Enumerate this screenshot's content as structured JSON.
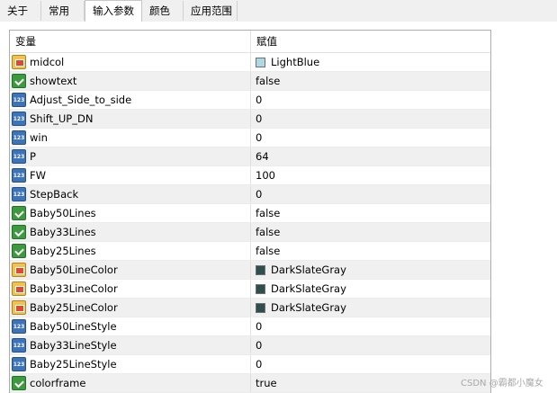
{
  "tabs": [
    {
      "label": "关于",
      "active": false
    },
    {
      "label": "常用",
      "active": false
    },
    {
      "label": "输入参数",
      "active": true
    },
    {
      "label": "颜色",
      "active": false
    },
    {
      "label": "应用范围",
      "active": false
    }
  ],
  "table": {
    "headers": {
      "variable": "变量",
      "value": "赋值"
    },
    "rows": [
      {
        "name": "midcol",
        "value": "LightBlue",
        "type": "color",
        "swatch": "#add8e6"
      },
      {
        "name": "showtext",
        "value": "false",
        "type": "bool"
      },
      {
        "name": "Adjust_Side_to_side",
        "value": "0",
        "type": "num"
      },
      {
        "name": "Shift_UP_DN",
        "value": "0",
        "type": "num"
      },
      {
        "name": "win",
        "value": "0",
        "type": "num"
      },
      {
        "name": "P",
        "value": "64",
        "type": "num"
      },
      {
        "name": "FW",
        "value": "100",
        "type": "num"
      },
      {
        "name": "StepBack",
        "value": "0",
        "type": "num"
      },
      {
        "name": "Baby50Lines",
        "value": "false",
        "type": "bool"
      },
      {
        "name": "Baby33Lines",
        "value": "false",
        "type": "bool"
      },
      {
        "name": "Baby25Lines",
        "value": "false",
        "type": "bool"
      },
      {
        "name": "Baby50LineColor",
        "value": "DarkSlateGray",
        "type": "color",
        "swatch": "#2f4f4f"
      },
      {
        "name": "Baby33LineColor",
        "value": "DarkSlateGray",
        "type": "color",
        "swatch": "#2f4f4f"
      },
      {
        "name": "Baby25LineColor",
        "value": "DarkSlateGray",
        "type": "color",
        "swatch": "#2f4f4f"
      },
      {
        "name": "Baby50LineStyle",
        "value": "0",
        "type": "num"
      },
      {
        "name": "Baby33LineStyle",
        "value": "0",
        "type": "num"
      },
      {
        "name": "Baby25LineStyle",
        "value": "0",
        "type": "num"
      },
      {
        "name": "colorframe",
        "value": "true",
        "type": "bool"
      }
    ]
  },
  "watermark": "CSDN @霸都小魔女"
}
